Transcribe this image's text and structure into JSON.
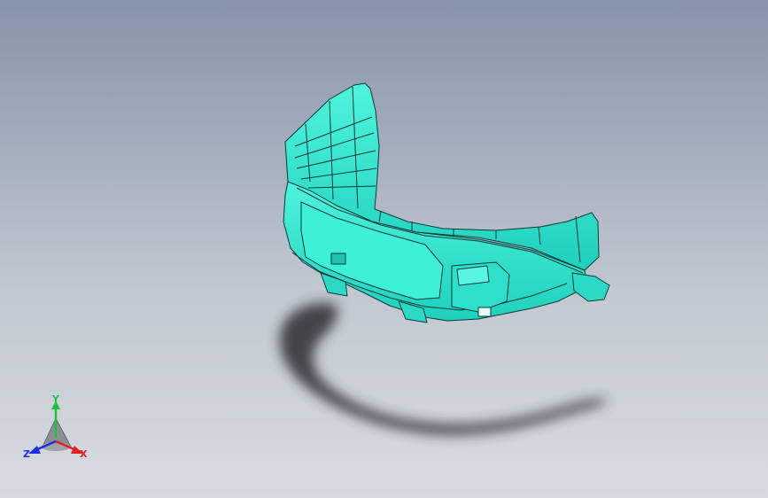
{
  "viewport": {
    "background_top": "#8794a8",
    "background_bottom": "#d7dbe1"
  },
  "model": {
    "face_color": "#33e8d2",
    "edge_color": "#0b3a38",
    "shadow_color": "#2a2d33"
  },
  "triad": {
    "x_label": "X",
    "y_label": "Y",
    "z_label": "Z",
    "x_color": "#e02020",
    "y_color": "#20c040",
    "z_color": "#2030e0"
  }
}
